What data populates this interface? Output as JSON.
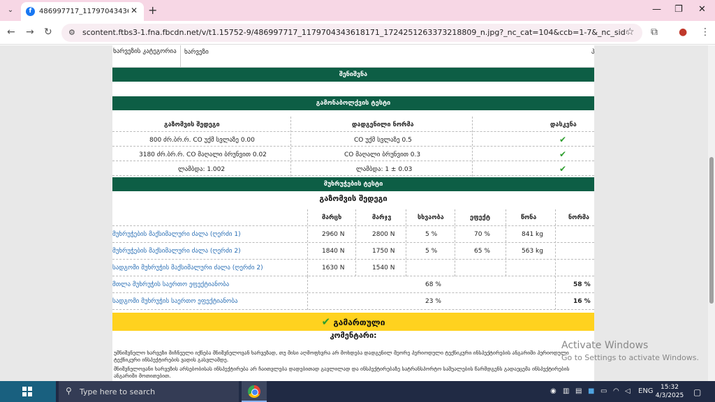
{
  "browser": {
    "tab_title": "486997717_1179704343618171",
    "url": "scontent.ftbs3-1.fna.fbcdn.net/v/t1.15752-9/486997717_1179704343618171_1724251263373218809_n.jpg?_nc_cat=104&ccb=1-7&_nc_sid=9f807c&_nc_ohc=Uyk4O..."
  },
  "doc": {
    "top_table": {
      "label": "ხარვეზის კატეგორია",
      "value": "ხარვეზი",
      "edge_char": "პ"
    },
    "notes_header": "შენიშვნა",
    "emissions_header": "გამონაბოლქვის ტესტი",
    "emissions_columns": [
      "გაზომვის შედეგი",
      "დადგენილი ნორმა",
      "დასკვნა"
    ],
    "emissions_rows": [
      {
        "result": "800 ძრ.ბრ.რ. CO უქმ სვლაზე 0.00",
        "norm": "CO უქმ სვლაზე 0.5"
      },
      {
        "result": "3180 ძრ.ბრ.რ. CO მაღალი ბრუნვით 0.02",
        "norm": "CO მაღალი ბრუნვით 0.3"
      },
      {
        "result": "ლამბდა: 1.002",
        "norm": "ლამბდა: 1 ± 0.03"
      }
    ],
    "brakes_header": "მუხრუჭების ტესტი",
    "brakes_subtitle": "გაზომვის შედეგი",
    "brakes_columns": [
      "მარცხ",
      "მარჯვ",
      "სხვაობა",
      "ეფექტ",
      "წონა",
      "ნორმა"
    ],
    "brakes_rows": [
      {
        "name": "მუხრუჭების მაქსიმალური ძალა (ღერძი 1)",
        "left": "2960 N",
        "right": "2800 N",
        "diff": "5 %",
        "eff": "70 %",
        "weight": "841 kg"
      },
      {
        "name": "მუხრუჭების მაქსიმალური ძალა (ღერძი 2)",
        "left": "1840 N",
        "right": "1750 N",
        "diff": "5 %",
        "eff": "65 %",
        "weight": "563 kg"
      },
      {
        "name": "სადგომი მუხრუჭის მაქსიმალური ძალა (ღერძი 2)",
        "left": "1630 N",
        "right": "1540 N",
        "diff": "",
        "eff": "",
        "weight": ""
      }
    ],
    "brakes_totals": [
      {
        "name": "მთლა მუხრუჭის საერთო ეფექტიანობა",
        "value": "68 %",
        "norm": "58 %"
      },
      {
        "name": "სადგომი მუხრუჭის საერთო ეფექტიანობა",
        "value": "23 %",
        "norm": "16 %"
      }
    ],
    "result_label": "გამართული",
    "comments_title": "კომენტარი:",
    "note1": "უმნიშვნელო ხარვეზი მიჩნეული იქნება მნიშვნელოვან ხარვეზად, თუ მისი აღმოფხვრა არ მოხდება დადგენილ მეორე პერიოდული ტექნიკური ინსპექტირების ანგარიში პერიოდული ტექნიკური ინსპექტირების ვადის გასვლამდე.",
    "note2": "მნიშვნელოვანი ხარვეზის არსებობისას ინსპექტირება არ ჩაითვლება დადებითად გავლილად და ინსპექტირებაზე სატრანსპორტო საშუალების წარმდგენს გადაეცემა ინსპექტირების ანგარიში მოთითებით."
  },
  "watermark": {
    "line1": "Activate Windows",
    "line2": "Go to Settings to activate Windows."
  },
  "taskbar": {
    "search_placeholder": "Type here to search",
    "lang": "ENG",
    "time": "15:32",
    "date": "4/3/2025"
  }
}
